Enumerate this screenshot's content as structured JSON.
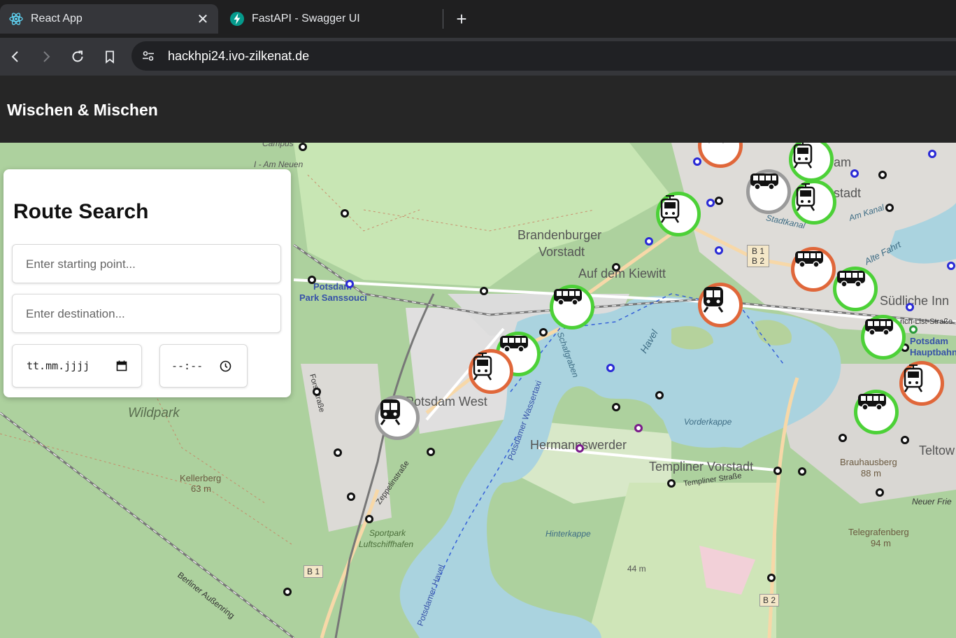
{
  "browser": {
    "tabs": [
      {
        "title": "React App",
        "icon": "react-icon",
        "active": true
      },
      {
        "title": "FastAPI - Swagger UI",
        "icon": "fastapi-icon",
        "active": false
      }
    ],
    "new_tab_icon": "plus-icon",
    "url": "hackhpi24.ivo-zilkenat.de"
  },
  "app": {
    "title": "Wischen & Mischen"
  },
  "search": {
    "heading": "Route Search",
    "start_placeholder": "Enter starting point...",
    "destination_placeholder": "Enter destination...",
    "date_value": "tt.mm.jjjj",
    "time_value": "--:--"
  },
  "map": {
    "labels": {
      "campus": "Campus",
      "campus2": "I - Am Neuen",
      "brandenburger": "Brandenburger",
      "vorstadt": "Vorstadt",
      "kiewitt": "Auf dem Kiewitt",
      "park_sanssouci_1": "Potsdam",
      "park_sanssouci_2": "Park Sanssouci",
      "potsdam_west": "Potsdam West",
      "wildpark": "Wildpark",
      "kellerberg": "Kellerberg",
      "kellerberg_h": "63 m",
      "hermannswerder": "Hermannswerder",
      "templiner_vorstadt": "Templiner Vorstadt",
      "templiner_strasse": "Templiner Straße",
      "vorderkappe": "Vorderkappe",
      "hinterkappe": "Hinterkappe",
      "brauhausberg": "Brauhausberg",
      "brauhausberg_h": "88 m",
      "telegrafenberg": "Telegrafenberg",
      "telegrafenberg_h": "94 m",
      "teltow": "Teltow",
      "neuer_fried": "Neuer Frie",
      "suedliche": "Südliche Inn",
      "hauptbahnhof_1": "Potsdam",
      "hauptbahnhof_2": "Hauptbahnhof",
      "stadt": "stadt",
      "am": "am",
      "stadtkanal": "Stadtkanal",
      "am_kanal": "Am Kanal",
      "alte_fahrt": "Alte Fahrt",
      "havel": "Havel",
      "schafgraben": "Schafgraben",
      "wasserstrasse": "Potsdamer Wassertaxi",
      "potsdamer_havel": "Potsdamer Havel",
      "zeppelinstrasse": "Zeppelinstraße",
      "forststrasse": "Forststraße",
      "berliner_aussenring": "Berliner Außenring",
      "sportpark_1": "Sportpark",
      "sportpark_2": "Luftschiffhafen",
      "b1": "B 1",
      "b1b2_1": "B 1",
      "b1b2_2": "B 2",
      "b2": "B 2",
      "h44": "44 m",
      "friedrich_list": "rich-List-Straße"
    },
    "marker_colors": {
      "green": "#4cd137",
      "orange": "#e0673a",
      "grey": "#9a9a9a"
    }
  }
}
